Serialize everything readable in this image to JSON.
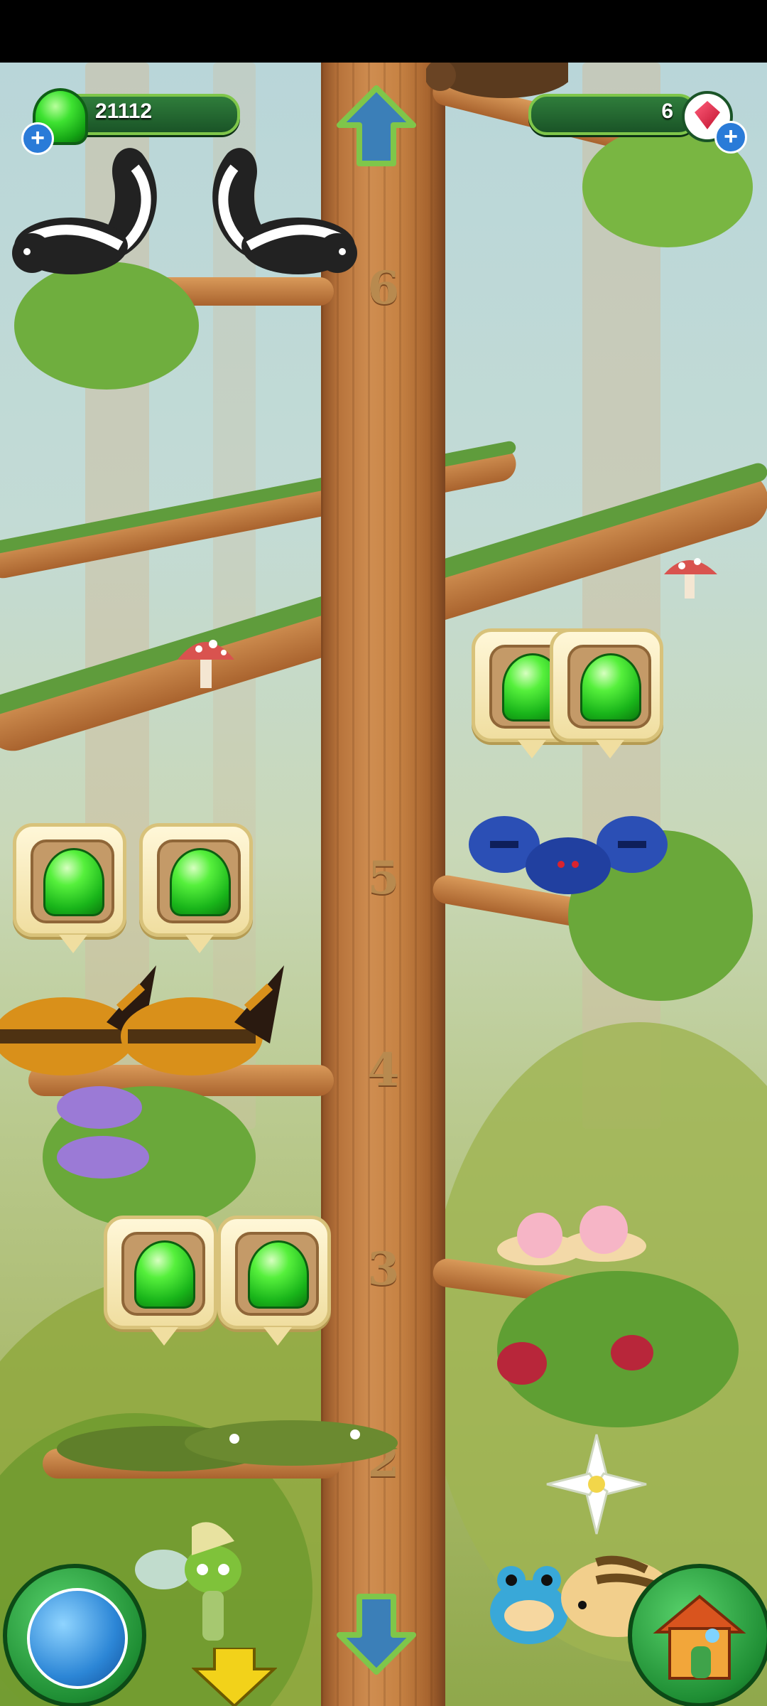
{
  "hud": {
    "jelly_count": "21112",
    "gem_count": "6"
  },
  "levels": [
    "6",
    "5",
    "4",
    "3",
    "2"
  ],
  "icons": {
    "up": "up-arrow-icon",
    "down": "down-arrow-icon",
    "world": "globe-icon",
    "home": "house-icon",
    "jelly": "green-jelly-icon",
    "gem": "red-gem-icon",
    "add": "plus-icon",
    "descend": "yellow-down-arrow-icon"
  },
  "colors": {
    "hud_bg": "#1a5427",
    "jelly_green": "#19b51a",
    "trunk": "#c78344"
  }
}
